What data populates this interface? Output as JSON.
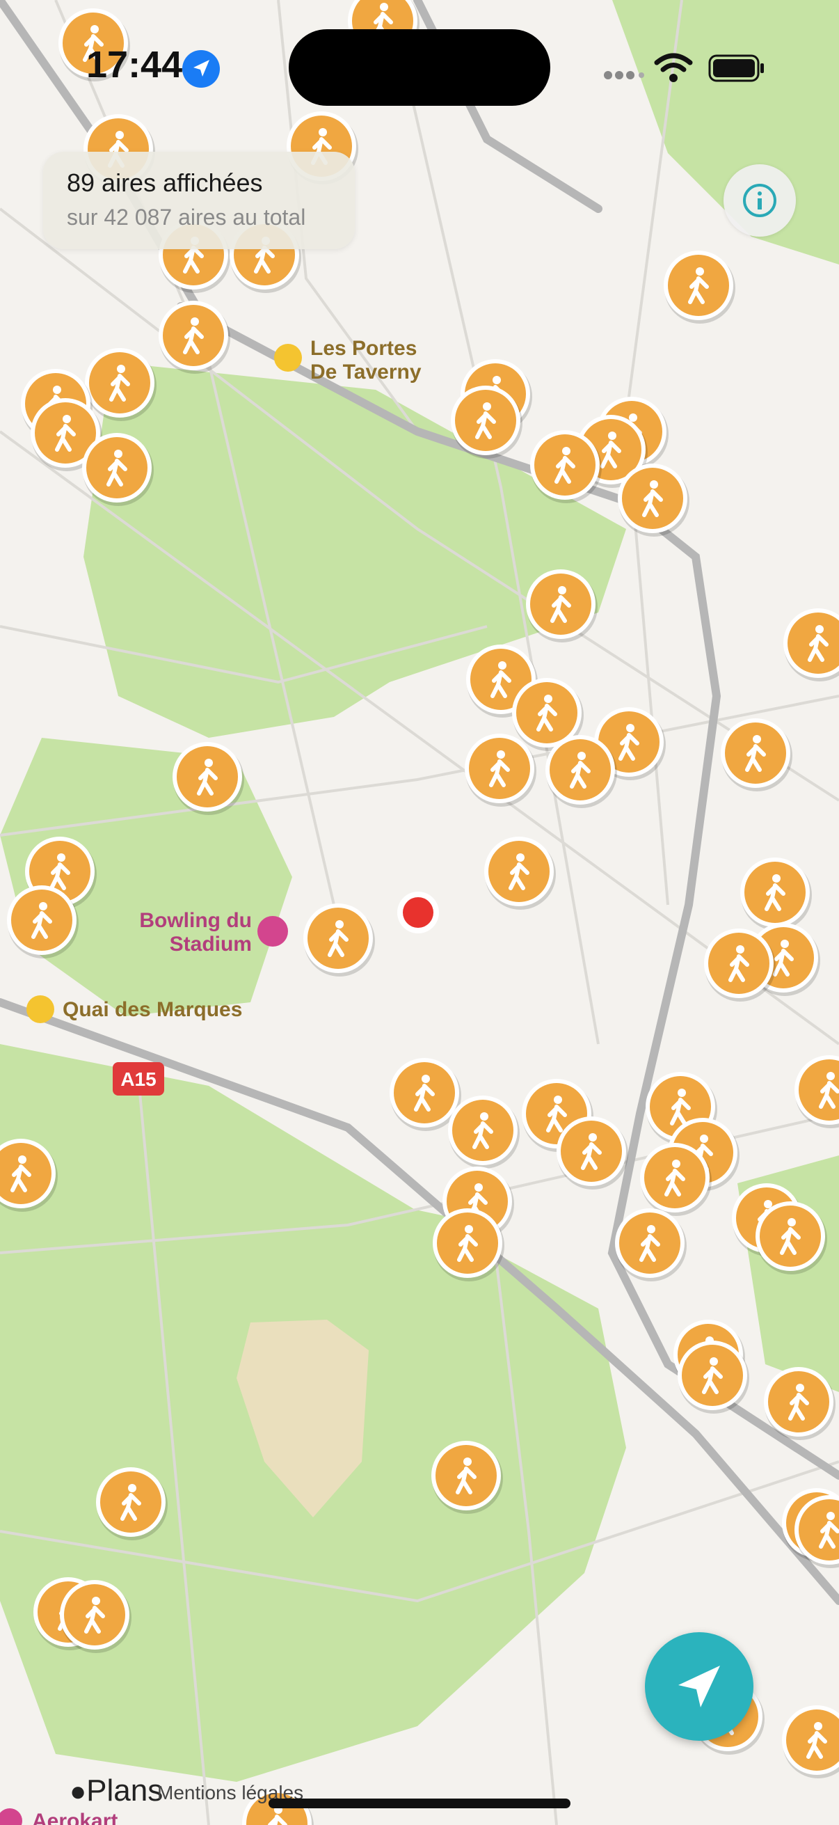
{
  "status_bar": {
    "time": "17:44"
  },
  "summary_card": {
    "title": "89 aires affichées",
    "subtitle": "sur 42 087 aires au total"
  },
  "map": {
    "labels": {
      "portes_line1": "Les Portes",
      "portes_line2": "De Taverny",
      "bowling_line1": "Bowling du",
      "bowling_line2": "Stadium",
      "quai": "Quai des Marques",
      "road_a15": "A15",
      "aerokart": "Aerokart"
    },
    "colors": {
      "marker": "#f0a741",
      "marker_border": "#ffffff",
      "current_location": "#e8322d",
      "park": "#bfe19a",
      "road": "#b6b6b6",
      "locate_button": "#2bb3bd",
      "highway_badge": "#e03a3a"
    }
  },
  "footer": {
    "brand": "Plans",
    "legal": "Mentions légales"
  },
  "icons": {
    "marker_icon": "walking-person-icon",
    "info": "info-icon",
    "locate": "location-arrow-icon"
  }
}
